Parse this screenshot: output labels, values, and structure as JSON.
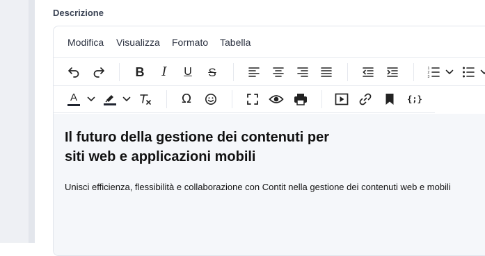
{
  "field": {
    "label": "Descrizione"
  },
  "menubar": {
    "items": [
      "Modifica",
      "Visualizza",
      "Formato",
      "Tabella"
    ]
  },
  "toolbar": {
    "row1": {
      "undo_icon": "undo-icon",
      "redo_icon": "redo-icon",
      "bold_label": "B",
      "italic_label": "I",
      "underline_label": "U",
      "strikethrough_label": "S"
    },
    "row2": {
      "text_color_label": "A",
      "clear_format_label": "T",
      "special_char_label": "Ω",
      "code_sample_label": "{;}",
      "text_color_bar": "#1f2430",
      "highlight_bar": "#1f2430"
    }
  },
  "content": {
    "heading": "Il futuro della gestione dei contenuti per siti web e applicazioni mobili",
    "paragraph": "Unisci efficienza, flessibilità e collaborazione con Contit nella gestione dei contenuti web e mobili"
  }
}
